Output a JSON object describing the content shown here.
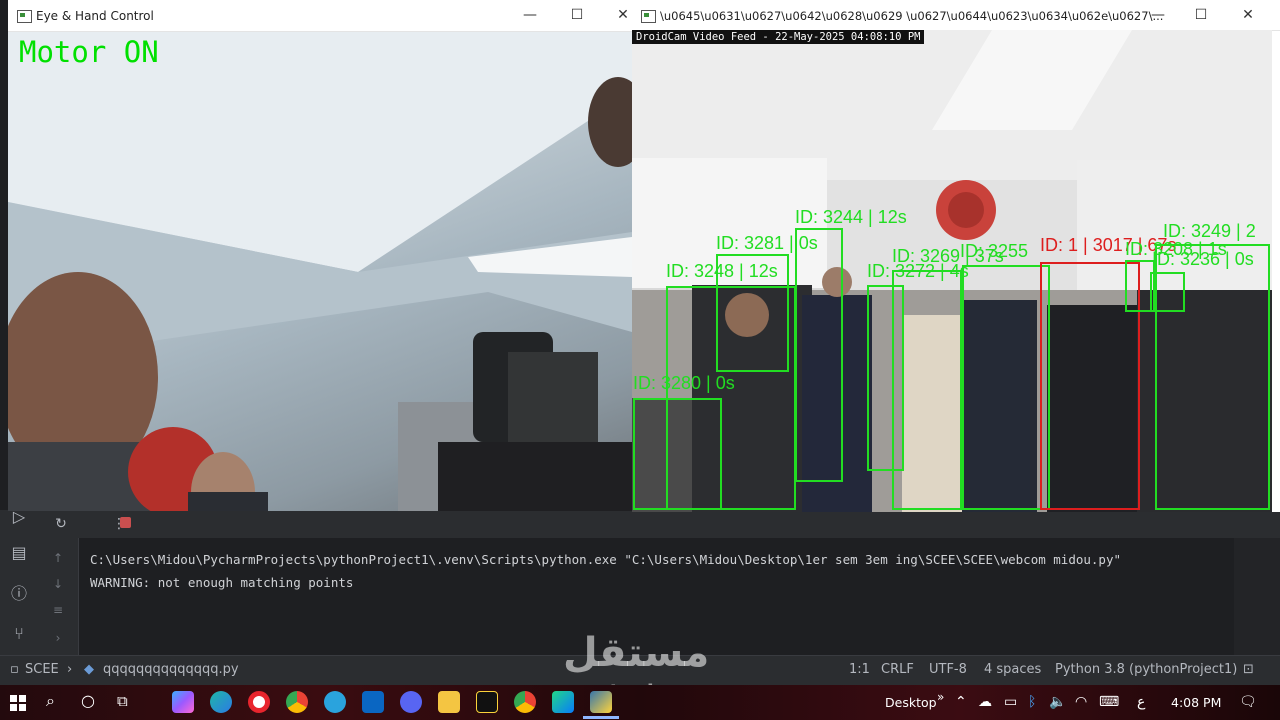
{
  "window_eye": {
    "title": "Eye & Hand Control",
    "overlay_text": "Motor ON",
    "controls": {
      "minimize": "—",
      "maximize": "☐",
      "close": "✕"
    }
  },
  "window_cam": {
    "title": "\\u0645\\u0631\\u0627\\u0642\\u0628\\u0629 \\u0627\\u0644\\u0623\\u0634\\u062e\\u0627\\...",
    "timestamp": "DroidCam Video Feed - 22-May-2025 04:08:10 PM",
    "controls": {
      "minimize": "—",
      "maximize": "☐",
      "close": "✕"
    },
    "detections": [
      {
        "label": "ID: 3281 | 0s",
        "color": "green"
      },
      {
        "label": "ID: 3244 | 12s",
        "color": "green"
      },
      {
        "label": "ID: 3248 | 12s",
        "color": "green"
      },
      {
        "label": "ID: 3272 | 4s",
        "color": "green"
      },
      {
        "label": "ID: 3269 | 37s",
        "color": "green"
      },
      {
        "label": "ID: 3255",
        "color": "green"
      },
      {
        "label": "ID: 1 | 3017 | 67s",
        "color": "red"
      },
      {
        "label": "ID: 3208 | 1s",
        "color": "green"
      },
      {
        "label": "ID: 3236 | 0s",
        "color": "green"
      },
      {
        "label": "ID: 3249 | 2",
        "color": "green"
      },
      {
        "label": "ID: 3280 | 0s",
        "color": "green"
      }
    ]
  },
  "ide": {
    "console_lines": [
      "C:\\Users\\Midou\\PycharmProjects\\pythonProject1\\.venv\\Scripts\\python.exe \"C:\\Users\\Midou\\Desktop\\1er sem 3em ing\\SCEE\\SCEE\\webcom midou.py\"",
      "WARNING: not enough matching points"
    ]
  },
  "statusbar": {
    "project": "SCEE",
    "file": "qqqqqqqqqqqqqq.py",
    "position": "1:1",
    "line_ending": "CRLF",
    "encoding": "UTF-8",
    "indent": "4 spaces",
    "interpreter": "Python 3.8 (pythonProject1)"
  },
  "taskbar": {
    "desktop_label": "Desktop",
    "language": "ع",
    "time": "4:08 PM"
  },
  "watermark": {
    "arabic": "مستقل",
    "latin": "mostaql.com"
  },
  "colors": {
    "detection_green": "#22dd22",
    "detection_red": "#dd1e1e",
    "overlay_green": "#00e000"
  }
}
